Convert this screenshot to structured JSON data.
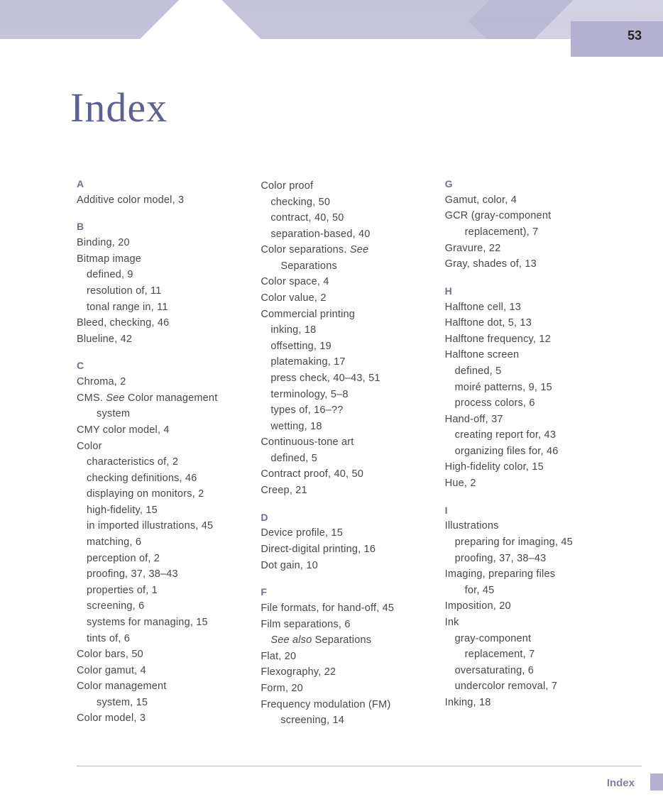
{
  "meta": {
    "page_number": "53",
    "title": "Index",
    "footer_label": "Index"
  },
  "cols": [
    [
      {
        "t": "letter",
        "v": "A"
      },
      {
        "t": "entry",
        "v": "Additive color model, 3"
      },
      {
        "t": "letter",
        "v": "B"
      },
      {
        "t": "entry",
        "v": "Binding, 20"
      },
      {
        "t": "entry",
        "v": "Bitmap image"
      },
      {
        "t": "sub",
        "v": "defined, 9"
      },
      {
        "t": "sub",
        "v": "resolution of, 11"
      },
      {
        "t": "sub",
        "v": "tonal range in, 11"
      },
      {
        "t": "entry",
        "v": "Bleed, checking, 46"
      },
      {
        "t": "entry",
        "v": "Blueline, 42"
      },
      {
        "t": "letter",
        "v": "C"
      },
      {
        "t": "entry",
        "v": "Chroma, 2"
      },
      {
        "t": "entry",
        "html": "CMS. <span class='see'>See</span> Color management"
      },
      {
        "t": "sub2",
        "v": "system"
      },
      {
        "t": "entry",
        "v": "CMY color model, 4"
      },
      {
        "t": "entry",
        "v": "Color"
      },
      {
        "t": "sub",
        "v": "characteristics of, 2"
      },
      {
        "t": "sub",
        "v": "checking definitions, 46"
      },
      {
        "t": "sub",
        "v": "displaying on monitors, 2"
      },
      {
        "t": "sub",
        "v": "high-fidelity, 15"
      },
      {
        "t": "sub",
        "v": "in imported illustrations, 45"
      },
      {
        "t": "sub",
        "v": "matching, 6"
      },
      {
        "t": "sub",
        "v": "perception of, 2"
      },
      {
        "t": "sub",
        "v": "proofing, 37, 38–43"
      },
      {
        "t": "sub",
        "v": "properties of, 1"
      },
      {
        "t": "sub",
        "v": "screening, 6"
      },
      {
        "t": "sub",
        "v": "systems for managing, 15"
      },
      {
        "t": "sub",
        "v": "tints of, 6"
      },
      {
        "t": "entry",
        "v": "Color bars, 50"
      },
      {
        "t": "entry",
        "v": "Color gamut, 4"
      },
      {
        "t": "entry",
        "v": "Color management"
      },
      {
        "t": "sub2",
        "v": "system, 15"
      },
      {
        "t": "entry",
        "v": "Color model, 3"
      }
    ],
    [
      {
        "t": "entry",
        "v": "Color proof"
      },
      {
        "t": "sub",
        "v": "checking, 50"
      },
      {
        "t": "sub",
        "v": "contract, 40, 50"
      },
      {
        "t": "sub",
        "v": "separation-based, 40"
      },
      {
        "t": "entry",
        "html": "Color separations. <span class='see'>See</span>"
      },
      {
        "t": "sub2",
        "v": "Separations"
      },
      {
        "t": "entry",
        "v": "Color space, 4"
      },
      {
        "t": "entry",
        "v": "Color value, 2"
      },
      {
        "t": "entry",
        "v": "Commercial printing"
      },
      {
        "t": "sub",
        "v": "inking, 18"
      },
      {
        "t": "sub",
        "v": "offsetting, 19"
      },
      {
        "t": "sub",
        "v": "platemaking, 17"
      },
      {
        "t": "sub",
        "v": "press check, 40–43, 51"
      },
      {
        "t": "sub",
        "v": "terminology, 5–8"
      },
      {
        "t": "sub",
        "v": "types of, 16–??"
      },
      {
        "t": "sub",
        "v": "wetting, 18"
      },
      {
        "t": "entry",
        "v": "Continuous-tone art"
      },
      {
        "t": "sub",
        "v": "defined, 5"
      },
      {
        "t": "entry",
        "v": "Contract proof, 40, 50"
      },
      {
        "t": "entry",
        "v": "Creep, 21"
      },
      {
        "t": "letter",
        "v": "D"
      },
      {
        "t": "entry",
        "v": "Device profile, 15"
      },
      {
        "t": "entry",
        "v": "Direct-digital printing, 16"
      },
      {
        "t": "entry",
        "v": "Dot gain, 10"
      },
      {
        "t": "letter",
        "v": "F"
      },
      {
        "t": "entry",
        "v": "File formats, for hand-off, 45"
      },
      {
        "t": "entry",
        "v": "Film separations, 6"
      },
      {
        "t": "sub",
        "html": "<span class='see'>See also</span> Separations"
      },
      {
        "t": "entry",
        "v": "Flat, 20"
      },
      {
        "t": "entry",
        "v": "Flexography, 22"
      },
      {
        "t": "entry",
        "v": "Form, 20"
      },
      {
        "t": "entry",
        "v": "Frequency modulation (FM)"
      },
      {
        "t": "sub2",
        "v": "screening, 14"
      }
    ],
    [
      {
        "t": "letter",
        "v": "G"
      },
      {
        "t": "entry",
        "v": "Gamut, color, 4"
      },
      {
        "t": "entry",
        "v": "GCR (gray-component"
      },
      {
        "t": "sub2",
        "v": "replacement), 7"
      },
      {
        "t": "entry",
        "v": "Gravure, 22"
      },
      {
        "t": "entry",
        "v": "Gray, shades of, 13"
      },
      {
        "t": "letter",
        "v": "H"
      },
      {
        "t": "entry",
        "v": "Halftone cell, 13"
      },
      {
        "t": "entry",
        "v": "Halftone dot, 5, 13"
      },
      {
        "t": "entry",
        "v": "Halftone frequency, 12"
      },
      {
        "t": "entry",
        "v": "Halftone screen"
      },
      {
        "t": "sub",
        "v": "defined, 5"
      },
      {
        "t": "sub",
        "v": "moiré patterns, 9, 15"
      },
      {
        "t": "sub",
        "v": "process colors, 6"
      },
      {
        "t": "entry",
        "v": "Hand-off, 37"
      },
      {
        "t": "sub",
        "v": "creating report for, 43"
      },
      {
        "t": "sub",
        "v": "organizing files for, 46"
      },
      {
        "t": "entry",
        "v": "High-fidelity color, 15"
      },
      {
        "t": "entry",
        "v": "Hue, 2"
      },
      {
        "t": "letter",
        "v": "I"
      },
      {
        "t": "entry",
        "v": "Illustrations"
      },
      {
        "t": "sub",
        "v": "preparing for imaging, 45"
      },
      {
        "t": "sub",
        "v": "proofing, 37, 38–43"
      },
      {
        "t": "entry",
        "v": "Imaging, preparing files"
      },
      {
        "t": "sub2",
        "v": "for, 45"
      },
      {
        "t": "entry",
        "v": "Imposition, 20"
      },
      {
        "t": "entry",
        "v": "Ink"
      },
      {
        "t": "sub",
        "v": "gray-component"
      },
      {
        "t": "sub2",
        "v": "replacement, 7"
      },
      {
        "t": "sub",
        "v": "oversaturating, 6"
      },
      {
        "t": "sub",
        "v": "undercolor removal, 7"
      },
      {
        "t": "entry",
        "v": "Inking, 18"
      }
    ]
  ]
}
